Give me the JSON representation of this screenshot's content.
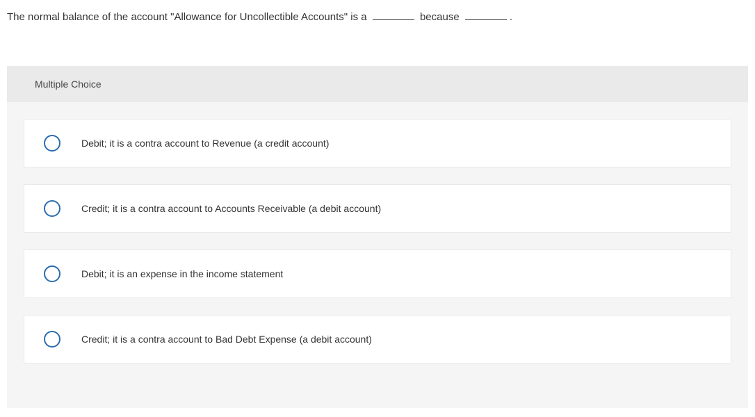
{
  "question": {
    "prefix": "The normal balance of the account \"Allowance for Uncollectible Accounts\" is a",
    "mid": "because",
    "suffix": "."
  },
  "section_label": "Multiple Choice",
  "options": [
    {
      "text": "Debit; it is a contra account to Revenue (a credit account)"
    },
    {
      "text": "Credit; it is a contra account to Accounts Receivable (a debit account)"
    },
    {
      "text": "Debit; it is an expense in the income statement"
    },
    {
      "text": "Credit; it is a contra account to Bad Debt Expense (a debit account)"
    }
  ]
}
